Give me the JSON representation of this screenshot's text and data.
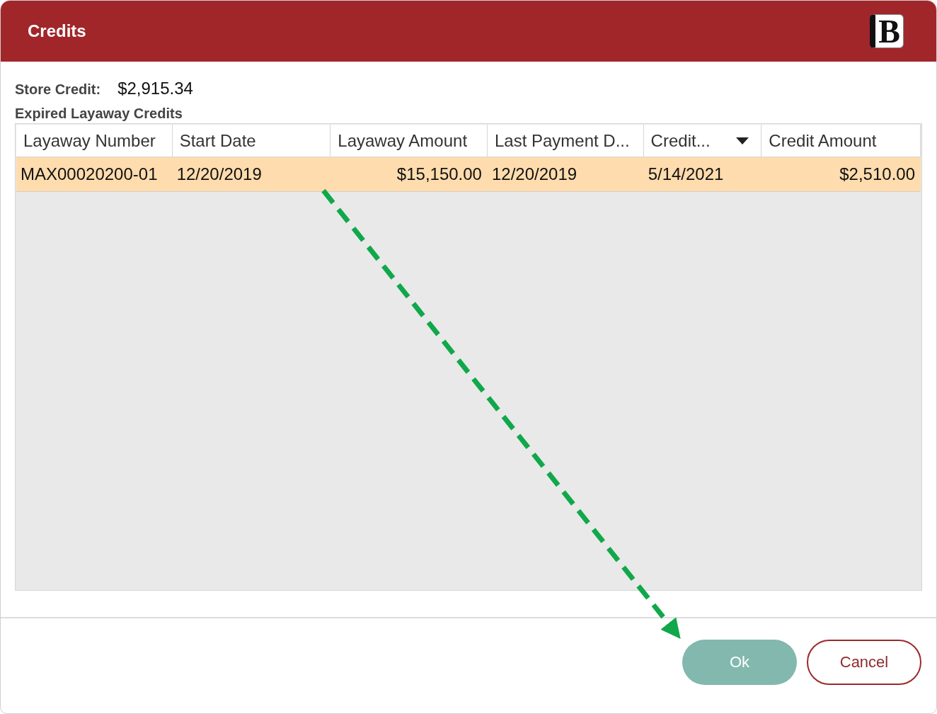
{
  "window": {
    "title": "Credits",
    "logo": "B"
  },
  "store_credit": {
    "label": "Store Credit:",
    "value": "$2,915.34"
  },
  "section_title": "Expired Layaway Credits",
  "table": {
    "columns": [
      {
        "label": "Layaway Number",
        "kind": "text",
        "sorted": false
      },
      {
        "label": "Start Date",
        "kind": "text",
        "sorted": false
      },
      {
        "label": "Layaway Amount",
        "kind": "amount",
        "sorted": false
      },
      {
        "label": "Last Payment D...",
        "kind": "text",
        "sorted": false
      },
      {
        "label": "Credit...",
        "kind": "text",
        "sorted": true
      },
      {
        "label": "Credit Amount",
        "kind": "amount",
        "sorted": false
      }
    ],
    "rows": [
      {
        "selected": true,
        "cells": [
          "MAX00020200-01",
          "12/20/2019",
          "$15,150.00",
          "12/20/2019",
          "5/14/2021",
          "$2,510.00"
        ]
      }
    ]
  },
  "buttons": [
    {
      "label": "Ok",
      "kind": "primary"
    },
    {
      "label": "Cancel",
      "kind": "secondary"
    }
  ]
}
